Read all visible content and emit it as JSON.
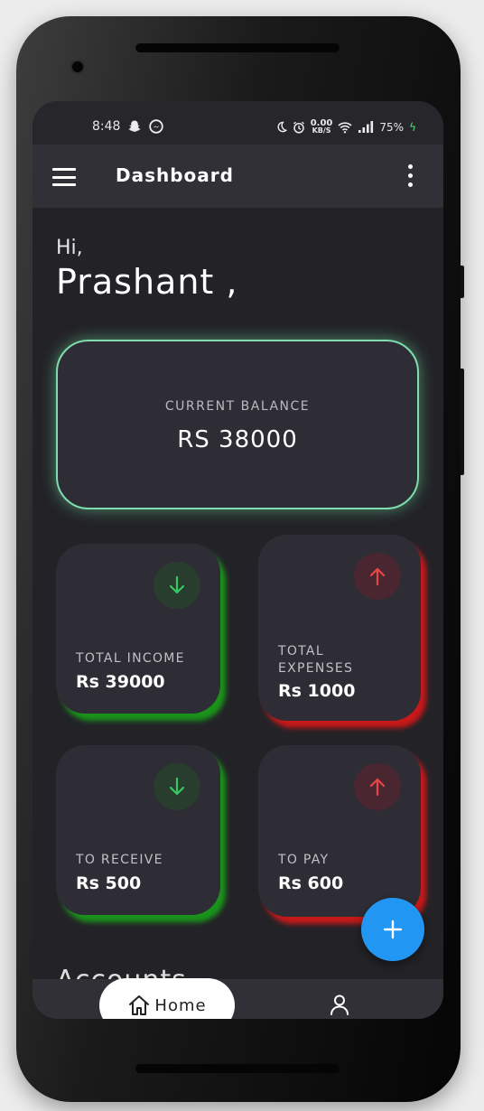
{
  "status_bar": {
    "time": "8:48",
    "net_speed_value": "0.00",
    "net_speed_unit": "KB/S",
    "battery": "75%"
  },
  "app_bar": {
    "title": "Dashboard"
  },
  "greeting": {
    "hi": "Hi,",
    "name": "Prashant ,"
  },
  "balance": {
    "label": "CURRENT BALANCE",
    "value": "RS 38000"
  },
  "cards": [
    {
      "label": "TOTAL INCOME",
      "value": "Rs 39000",
      "direction": "down",
      "color": "#37c760"
    },
    {
      "label": "TOTAL EXPENSES",
      "value": "Rs 1000",
      "direction": "up",
      "color": "#e84545"
    },
    {
      "label": "TO RECEIVE",
      "value": "Rs 500",
      "direction": "down",
      "color": "#37c760"
    },
    {
      "label": "TO PAY",
      "value": "Rs 600",
      "direction": "up",
      "color": "#e84545"
    }
  ],
  "sections": {
    "accounts": "Accounts"
  },
  "bottom_nav": {
    "home_label": "Home"
  },
  "colors": {
    "accent_blue": "#2196f3",
    "balance_border": "#7fdcae",
    "income_green": "#37c760",
    "expense_red": "#e84545"
  }
}
